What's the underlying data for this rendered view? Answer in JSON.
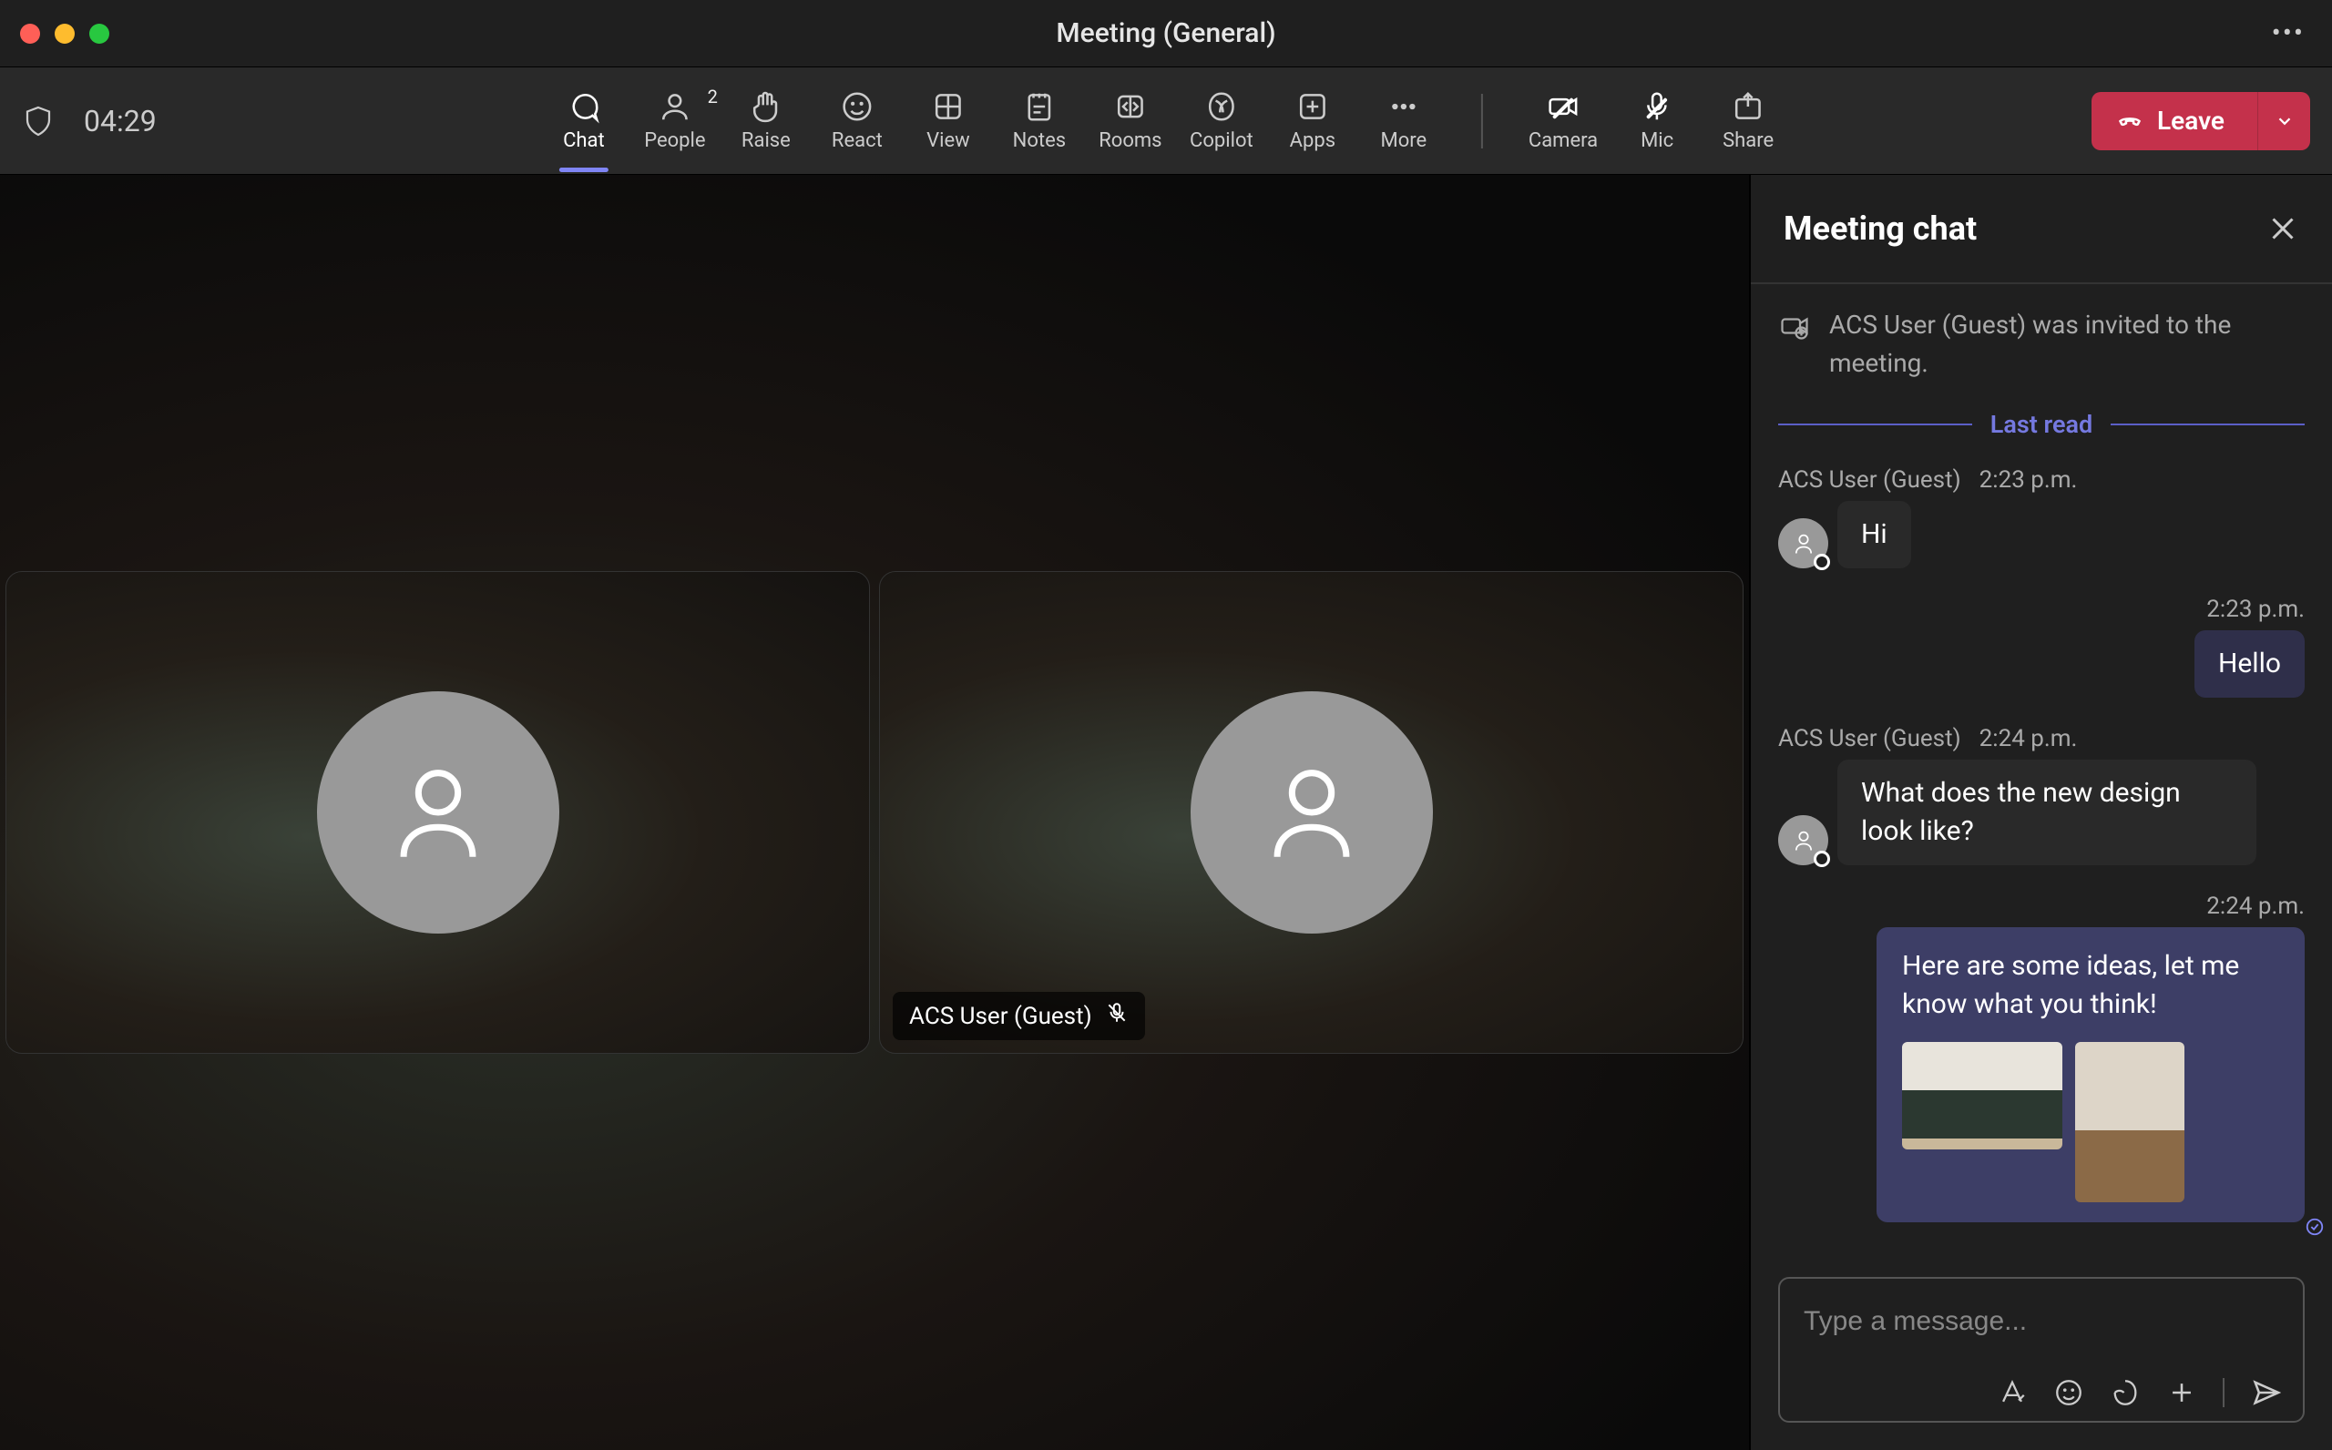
{
  "window": {
    "title": "Meeting (General)"
  },
  "timer": "04:29",
  "toolbar": {
    "chat": "Chat",
    "people": "People",
    "people_count": "2",
    "raise": "Raise",
    "react": "React",
    "view": "View",
    "notes": "Notes",
    "rooms": "Rooms",
    "copilot": "Copilot",
    "apps": "Apps",
    "more": "More",
    "camera": "Camera",
    "mic": "Mic",
    "share": "Share",
    "leave": "Leave"
  },
  "tiles": {
    "guest_name": "ACS User (Guest)"
  },
  "chat": {
    "title": "Meeting chat",
    "system": "ACS User (Guest) was invited to the meeting.",
    "last_read": "Last read",
    "msgs": [
      {
        "sender": "ACS User (Guest)",
        "time": "2:23 p.m.",
        "text": "Hi"
      },
      {
        "time": "2:23 p.m.",
        "text": "Hello"
      },
      {
        "sender": "ACS User (Guest)",
        "time": "2:24 p.m.",
        "text": "What does the new design look like?"
      },
      {
        "time": "2:24 p.m.",
        "text": "Here are some ideas, let me know what you think!"
      }
    ],
    "compose_placeholder": "Type a message..."
  }
}
